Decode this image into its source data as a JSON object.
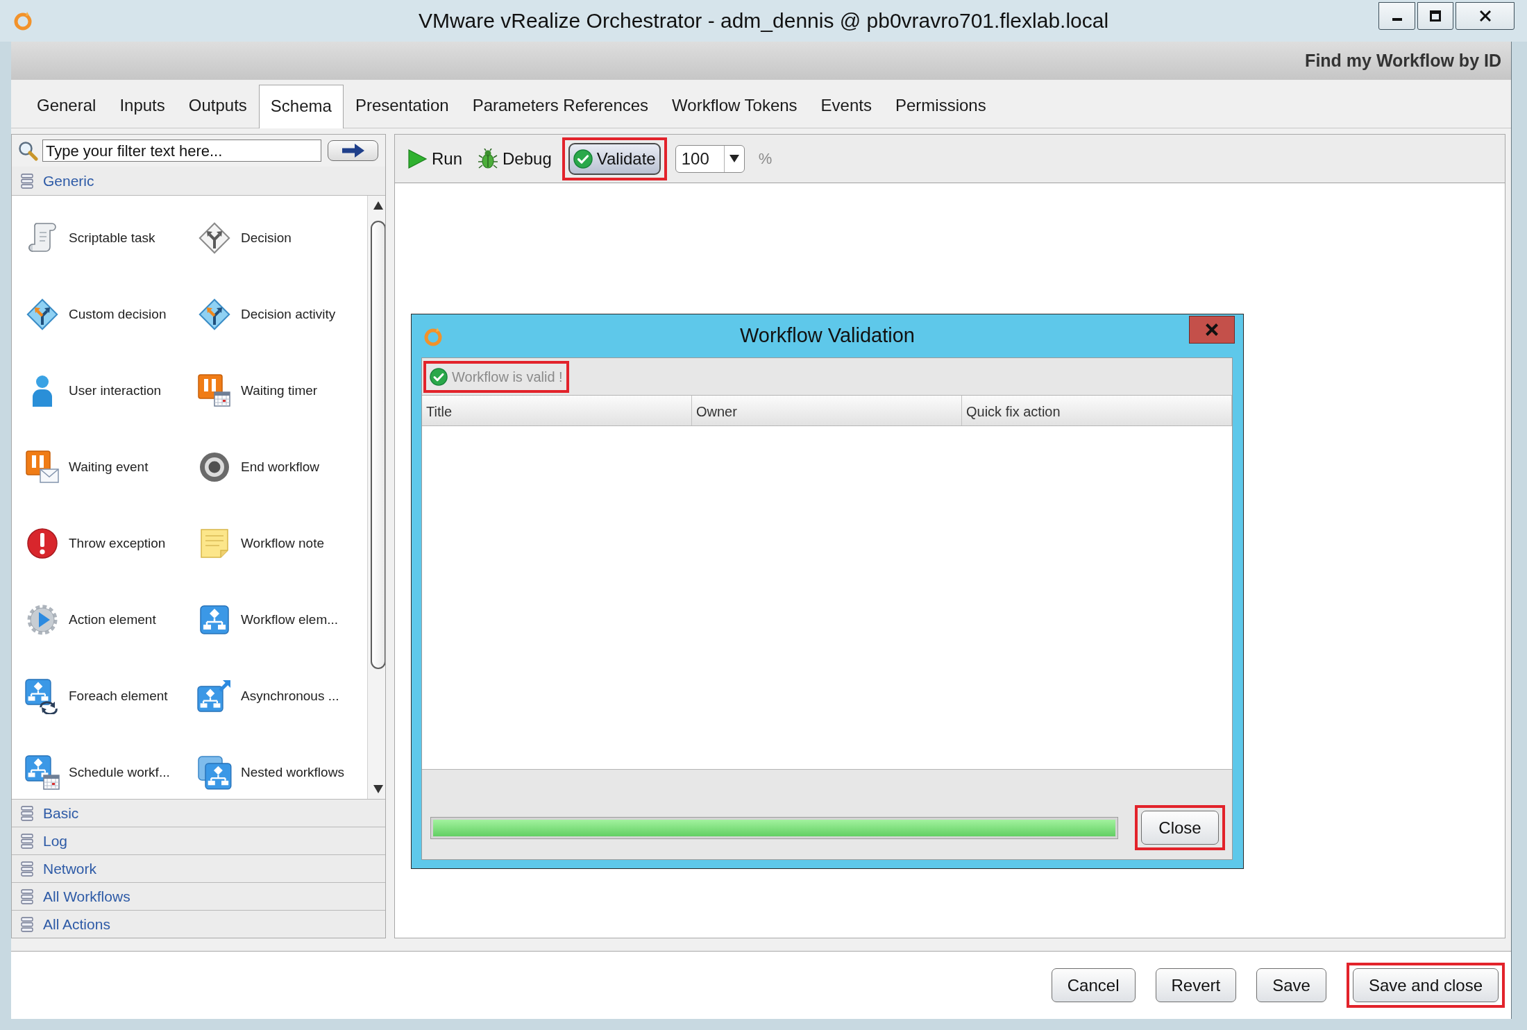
{
  "window": {
    "title": "VMware vRealize Orchestrator - adm_dennis @ pb0vravro701.flexlab.local"
  },
  "header": {
    "title": "Find my Workflow by ID"
  },
  "tabs": [
    {
      "label": "General",
      "selected": false
    },
    {
      "label": "Inputs",
      "selected": false
    },
    {
      "label": "Outputs",
      "selected": false
    },
    {
      "label": "Schema",
      "selected": true
    },
    {
      "label": "Presentation",
      "selected": false
    },
    {
      "label": "Parameters References",
      "selected": false
    },
    {
      "label": "Workflow Tokens",
      "selected": false
    },
    {
      "label": "Events",
      "selected": false
    },
    {
      "label": "Permissions",
      "selected": false
    }
  ],
  "palette": {
    "filter": {
      "placeholder": "Type your filter text here..."
    },
    "groups": [
      {
        "label": "Generic",
        "items": [
          {
            "kind": "scroll",
            "label": "Scriptable task"
          },
          {
            "kind": "diamond",
            "label": "Decision"
          },
          {
            "kind": "forkdiamond",
            "label": "Custom decision"
          },
          {
            "kind": "forkdiamond",
            "label": "Decision activity"
          },
          {
            "kind": "person",
            "label": "User interaction"
          },
          {
            "kind": "timer",
            "label": "Waiting timer"
          },
          {
            "kind": "mail",
            "label": "Waiting event"
          },
          {
            "kind": "stop",
            "label": "End workflow"
          },
          {
            "kind": "alert",
            "label": "Throw exception"
          },
          {
            "kind": "note",
            "label": "Workflow note"
          },
          {
            "kind": "gear",
            "label": "Action element"
          },
          {
            "kind": "flow",
            "label": "Workflow elem..."
          },
          {
            "kind": "loop",
            "label": "Foreach element"
          },
          {
            "kind": "async",
            "label": "Asynchronous ..."
          },
          {
            "kind": "schedule",
            "label": "Schedule workf..."
          },
          {
            "kind": "nested",
            "label": "Nested workflows"
          }
        ]
      },
      {
        "label": "Basic"
      },
      {
        "label": "Log"
      },
      {
        "label": "Network"
      },
      {
        "label": "All Workflows"
      },
      {
        "label": "All Actions"
      }
    ]
  },
  "toolbar": {
    "items": [
      {
        "kind": "run",
        "label": "Run",
        "pressed": false,
        "highlighted": false
      },
      {
        "kind": "debug",
        "label": "Debug",
        "pressed": false,
        "highlighted": false
      },
      {
        "kind": "validate",
        "label": "Validate",
        "pressed": true,
        "highlighted": true
      }
    ],
    "zoom": {
      "value": "100",
      "unit": "%"
    }
  },
  "dialog": {
    "title": "Workflow Validation",
    "status": {
      "text": "Workflow is valid !",
      "valid": true,
      "highlighted": true
    },
    "columns": [
      "Title",
      "Owner",
      "Quick fix action"
    ],
    "progress": {
      "level": 1
    },
    "close_button": {
      "label": "Close",
      "highlighted": true
    }
  },
  "footer": {
    "buttons": [
      {
        "label": "Cancel",
        "highlighted": false
      },
      {
        "label": "Revert",
        "highlighted": false
      },
      {
        "label": "Save",
        "highlighted": false
      },
      {
        "label": "Save and close",
        "highlighted": true
      }
    ]
  }
}
